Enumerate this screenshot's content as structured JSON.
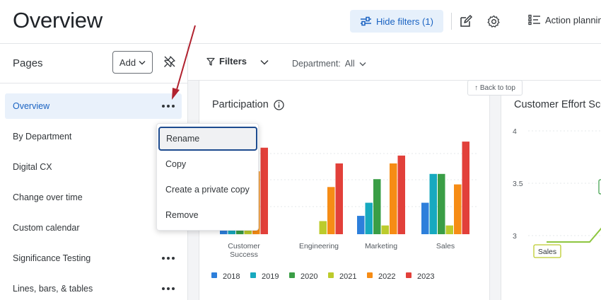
{
  "header": {
    "title": "Overview",
    "hide_filters_label": "Hide filters (1)",
    "action_planning_label": "Action planning"
  },
  "sidebar": {
    "title": "Pages",
    "add_label": "Add",
    "items": [
      {
        "label": "Overview",
        "active": true
      },
      {
        "label": "By Department"
      },
      {
        "label": "Digital CX"
      },
      {
        "label": "Change over time"
      },
      {
        "label": "Custom calendar"
      },
      {
        "label": "Significance Testing"
      },
      {
        "label": "Lines, bars, & tables"
      }
    ]
  },
  "filters": {
    "label": "Filters",
    "department_label": "Department:",
    "department_value": "All"
  },
  "back_to_top": "↑ Back to top",
  "context_menu": {
    "items": [
      "Rename",
      "Copy",
      "Create a private copy",
      "Remove"
    ]
  },
  "cards": {
    "participation_title": "Participation",
    "customer_effort_title": "Customer Effort Score"
  },
  "chart_data": [
    {
      "type": "bar",
      "title": "Participation",
      "categories": [
        "Customer Success",
        "Engineering",
        "Marketing",
        "Sales"
      ],
      "series": [
        {
          "name": "2018",
          "color": "#2d7fdb",
          "values": [
            0.05,
            0,
            0.21,
            0.36
          ]
        },
        {
          "name": "2019",
          "color": "#17a9bf",
          "values": [
            0.05,
            0,
            0.36,
            0.69
          ]
        },
        {
          "name": "2020",
          "color": "#3a9e46",
          "values": [
            0.05,
            0,
            0.63,
            0.69
          ]
        },
        {
          "name": "2021",
          "color": "#bccb2c",
          "values": [
            0.2,
            0.15,
            0.1,
            0.1
          ]
        },
        {
          "name": "2022",
          "color": "#f68c15",
          "values": [
            0.72,
            0.54,
            0.81,
            0.57
          ]
        },
        {
          "name": "2023",
          "color": "#e2403a",
          "values": [
            0.99,
            0.81,
            0.9,
            1.06
          ]
        }
      ],
      "ylim": [
        0,
        1.15
      ],
      "grid": true,
      "legend": "bottom"
    },
    {
      "type": "line",
      "title": "Customer Effort Score",
      "y_ticks": [
        "4",
        "3.5",
        "3"
      ],
      "ylim": [
        2.5,
        4.2
      ],
      "annotations": [
        "Sales"
      ],
      "grid": true
    }
  ]
}
